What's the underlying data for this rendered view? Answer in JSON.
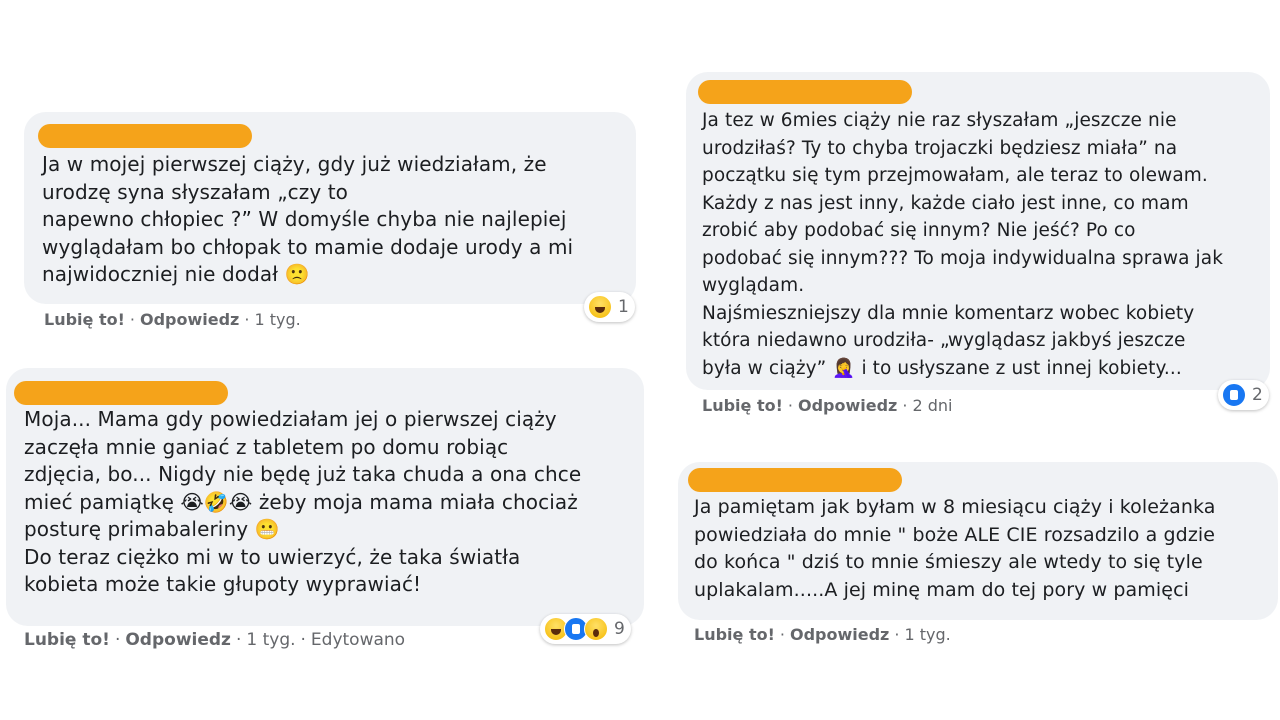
{
  "comments": [
    {
      "text": "Ja w mojej pierwszej ciąży, gdy już wiedziałam, że\nurodzę syna słyszałam „czy to\nnapewno chłopiec ?” W domyśle chyba nie najlepiej\nwyglądałam bo chłopak to mamie dodaje urody a mi\nnajwidoczniej nie dodał 🙁",
      "like_label": "Lubię to!",
      "reply_label": "Odpowiedz",
      "time": "1 tyg.",
      "reaction_count": "1",
      "reaction_icons": [
        "haha-icon"
      ]
    },
    {
      "text": "Moja... Mama gdy powiedziałam jej o pierwszej ciąży\nzaczęła mnie ganiać z tabletem po domu robiąc\nzdjęcia, bo... Nigdy nie będę już taka chuda a ona chce\nmieć pamiątkę 😭🤣😭 żeby moja mama miała chociaż\nposturę primabaleriny 😬\nDo teraz ciężko mi w to uwierzyć, że taka światła\nkobieta może takie głupoty wyprawiać!",
      "like_label": "Lubię to!",
      "reply_label": "Odpowiedz",
      "time": "1 tyg.",
      "edited": "Edytowano",
      "reaction_count": "9",
      "reaction_icons": [
        "haha-icon",
        "like-icon",
        "wow-icon"
      ]
    },
    {
      "text": "Ja tez w 6mies ciąży nie raz słyszałam „jeszcze nie\nurodziłaś? Ty to chyba trojaczki będziesz miała” na\npoczątku się tym przejmowałam, ale teraz to olewam.\nKażdy z nas jest inny, każde ciało jest inne, co mam\nzrobić aby podobać się innym? Nie jeść? Po co\npodobać się innym??? To moja indywidualna sprawa jak\nwyglądam.\nNajśmieszniejszy dla mnie komentarz wobec kobiety\nktóra niedawno urodziła- „wyglądasz jakbyś jeszcze\nbyła w ciąży” 🤦‍♀️ i to usłyszane z ust innej kobiety...",
      "like_label": "Lubię to!",
      "reply_label": "Odpowiedz",
      "time": "2 dni",
      "reaction_count": "2",
      "reaction_icons": [
        "like-icon"
      ]
    },
    {
      "text": "Ja pamiętam jak byłam w 8 miesiącu ciąży i koleżanka\npowiedziała do mnie \" boże ALE CIE rozsadzilo a gdzie\ndo końca \" dziś to mnie śmieszy ale wtedy to się tyle\nuplakalam.....A jej minę mam do tej pory w pamięci",
      "like_label": "Lubię to!",
      "reply_label": "Odpowiedz",
      "time": "1 tyg."
    }
  ],
  "colors": {
    "name_redaction": "#f5a31a",
    "bubble": "#f0f2f5",
    "meta": "#65676b"
  }
}
